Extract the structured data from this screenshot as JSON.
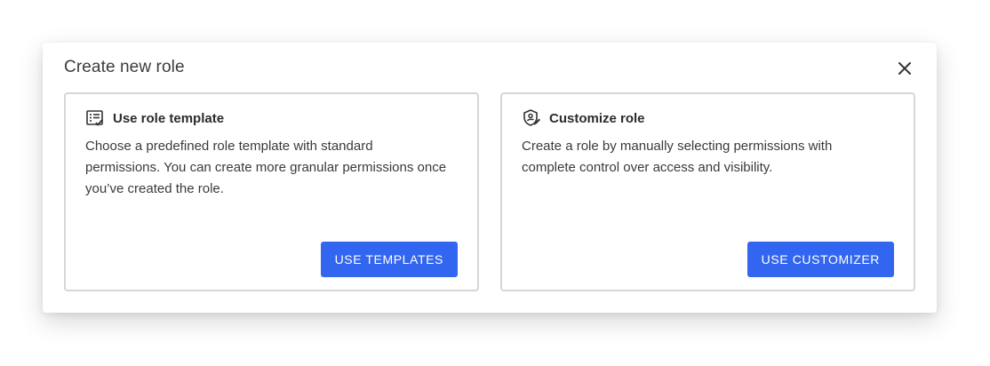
{
  "dialog": {
    "title": "Create new role"
  },
  "cards": {
    "template": {
      "icon": "list-check-icon",
      "title": "Use role template",
      "description": "Choose a predefined role template with standard permissions. You can create more granular permissions once you’ve created the role.",
      "button_label": "USE TEMPLATES"
    },
    "customize": {
      "icon": "shield-edit-icon",
      "title": "Customize role",
      "description": "Create a role by manually selecting permissions with complete control over access and visibility.",
      "button_label": "USE CUSTOMIZER"
    }
  },
  "colors": {
    "accent": "#3366f0",
    "card_border": "#d6d6d6"
  }
}
